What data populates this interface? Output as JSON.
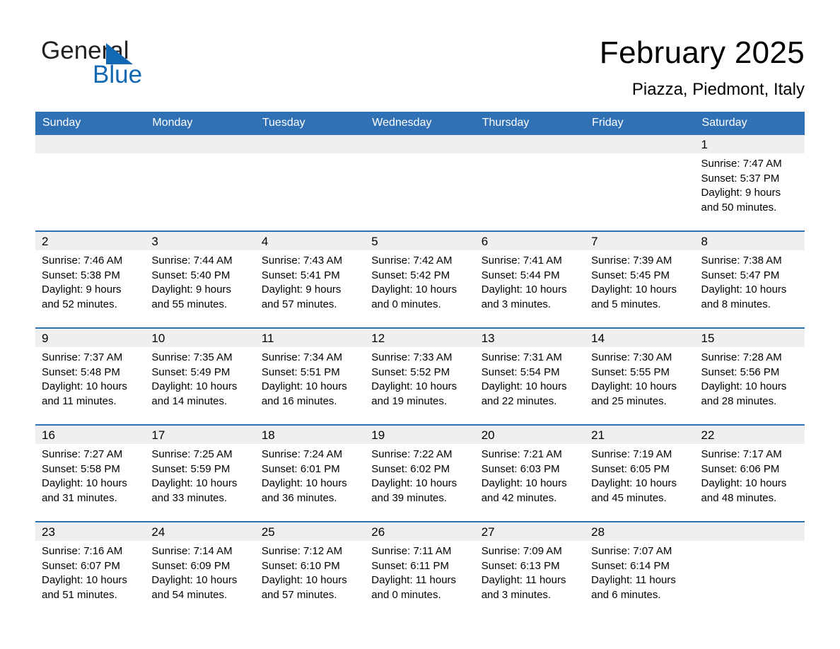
{
  "brand": {
    "name_part1": "General",
    "name_part2": "Blue",
    "triangle_color": "#1268b3"
  },
  "header": {
    "title": "February 2025",
    "subtitle": "Piazza, Piedmont, Italy",
    "accent_color": "#3071b5",
    "band_color": "#efefef"
  },
  "weekdays": [
    "Sunday",
    "Monday",
    "Tuesday",
    "Wednesday",
    "Thursday",
    "Friday",
    "Saturday"
  ],
  "weeks": [
    [
      {
        "day": "",
        "empty": true
      },
      {
        "day": "",
        "empty": true
      },
      {
        "day": "",
        "empty": true
      },
      {
        "day": "",
        "empty": true
      },
      {
        "day": "",
        "empty": true
      },
      {
        "day": "",
        "empty": true
      },
      {
        "day": "1",
        "sunrise": "Sunrise: 7:47 AM",
        "sunset": "Sunset: 5:37 PM",
        "daylight_line1": "Daylight: 9 hours",
        "daylight_line2": "and 50 minutes."
      }
    ],
    [
      {
        "day": "2",
        "sunrise": "Sunrise: 7:46 AM",
        "sunset": "Sunset: 5:38 PM",
        "daylight_line1": "Daylight: 9 hours",
        "daylight_line2": "and 52 minutes."
      },
      {
        "day": "3",
        "sunrise": "Sunrise: 7:44 AM",
        "sunset": "Sunset: 5:40 PM",
        "daylight_line1": "Daylight: 9 hours",
        "daylight_line2": "and 55 minutes."
      },
      {
        "day": "4",
        "sunrise": "Sunrise: 7:43 AM",
        "sunset": "Sunset: 5:41 PM",
        "daylight_line1": "Daylight: 9 hours",
        "daylight_line2": "and 57 minutes."
      },
      {
        "day": "5",
        "sunrise": "Sunrise: 7:42 AM",
        "sunset": "Sunset: 5:42 PM",
        "daylight_line1": "Daylight: 10 hours",
        "daylight_line2": "and 0 minutes."
      },
      {
        "day": "6",
        "sunrise": "Sunrise: 7:41 AM",
        "sunset": "Sunset: 5:44 PM",
        "daylight_line1": "Daylight: 10 hours",
        "daylight_line2": "and 3 minutes."
      },
      {
        "day": "7",
        "sunrise": "Sunrise: 7:39 AM",
        "sunset": "Sunset: 5:45 PM",
        "daylight_line1": "Daylight: 10 hours",
        "daylight_line2": "and 5 minutes."
      },
      {
        "day": "8",
        "sunrise": "Sunrise: 7:38 AM",
        "sunset": "Sunset: 5:47 PM",
        "daylight_line1": "Daylight: 10 hours",
        "daylight_line2": "and 8 minutes."
      }
    ],
    [
      {
        "day": "9",
        "sunrise": "Sunrise: 7:37 AM",
        "sunset": "Sunset: 5:48 PM",
        "daylight_line1": "Daylight: 10 hours",
        "daylight_line2": "and 11 minutes."
      },
      {
        "day": "10",
        "sunrise": "Sunrise: 7:35 AM",
        "sunset": "Sunset: 5:49 PM",
        "daylight_line1": "Daylight: 10 hours",
        "daylight_line2": "and 14 minutes."
      },
      {
        "day": "11",
        "sunrise": "Sunrise: 7:34 AM",
        "sunset": "Sunset: 5:51 PM",
        "daylight_line1": "Daylight: 10 hours",
        "daylight_line2": "and 16 minutes."
      },
      {
        "day": "12",
        "sunrise": "Sunrise: 7:33 AM",
        "sunset": "Sunset: 5:52 PM",
        "daylight_line1": "Daylight: 10 hours",
        "daylight_line2": "and 19 minutes."
      },
      {
        "day": "13",
        "sunrise": "Sunrise: 7:31 AM",
        "sunset": "Sunset: 5:54 PM",
        "daylight_line1": "Daylight: 10 hours",
        "daylight_line2": "and 22 minutes."
      },
      {
        "day": "14",
        "sunrise": "Sunrise: 7:30 AM",
        "sunset": "Sunset: 5:55 PM",
        "daylight_line1": "Daylight: 10 hours",
        "daylight_line2": "and 25 minutes."
      },
      {
        "day": "15",
        "sunrise": "Sunrise: 7:28 AM",
        "sunset": "Sunset: 5:56 PM",
        "daylight_line1": "Daylight: 10 hours",
        "daylight_line2": "and 28 minutes."
      }
    ],
    [
      {
        "day": "16",
        "sunrise": "Sunrise: 7:27 AM",
        "sunset": "Sunset: 5:58 PM",
        "daylight_line1": "Daylight: 10 hours",
        "daylight_line2": "and 31 minutes."
      },
      {
        "day": "17",
        "sunrise": "Sunrise: 7:25 AM",
        "sunset": "Sunset: 5:59 PM",
        "daylight_line1": "Daylight: 10 hours",
        "daylight_line2": "and 33 minutes."
      },
      {
        "day": "18",
        "sunrise": "Sunrise: 7:24 AM",
        "sunset": "Sunset: 6:01 PM",
        "daylight_line1": "Daylight: 10 hours",
        "daylight_line2": "and 36 minutes."
      },
      {
        "day": "19",
        "sunrise": "Sunrise: 7:22 AM",
        "sunset": "Sunset: 6:02 PM",
        "daylight_line1": "Daylight: 10 hours",
        "daylight_line2": "and 39 minutes."
      },
      {
        "day": "20",
        "sunrise": "Sunrise: 7:21 AM",
        "sunset": "Sunset: 6:03 PM",
        "daylight_line1": "Daylight: 10 hours",
        "daylight_line2": "and 42 minutes."
      },
      {
        "day": "21",
        "sunrise": "Sunrise: 7:19 AM",
        "sunset": "Sunset: 6:05 PM",
        "daylight_line1": "Daylight: 10 hours",
        "daylight_line2": "and 45 minutes."
      },
      {
        "day": "22",
        "sunrise": "Sunrise: 7:17 AM",
        "sunset": "Sunset: 6:06 PM",
        "daylight_line1": "Daylight: 10 hours",
        "daylight_line2": "and 48 minutes."
      }
    ],
    [
      {
        "day": "23",
        "sunrise": "Sunrise: 7:16 AM",
        "sunset": "Sunset: 6:07 PM",
        "daylight_line1": "Daylight: 10 hours",
        "daylight_line2": "and 51 minutes."
      },
      {
        "day": "24",
        "sunrise": "Sunrise: 7:14 AM",
        "sunset": "Sunset: 6:09 PM",
        "daylight_line1": "Daylight: 10 hours",
        "daylight_line2": "and 54 minutes."
      },
      {
        "day": "25",
        "sunrise": "Sunrise: 7:12 AM",
        "sunset": "Sunset: 6:10 PM",
        "daylight_line1": "Daylight: 10 hours",
        "daylight_line2": "and 57 minutes."
      },
      {
        "day": "26",
        "sunrise": "Sunrise: 7:11 AM",
        "sunset": "Sunset: 6:11 PM",
        "daylight_line1": "Daylight: 11 hours",
        "daylight_line2": "and 0 minutes."
      },
      {
        "day": "27",
        "sunrise": "Sunrise: 7:09 AM",
        "sunset": "Sunset: 6:13 PM",
        "daylight_line1": "Daylight: 11 hours",
        "daylight_line2": "and 3 minutes."
      },
      {
        "day": "28",
        "sunrise": "Sunrise: 7:07 AM",
        "sunset": "Sunset: 6:14 PM",
        "daylight_line1": "Daylight: 11 hours",
        "daylight_line2": "and 6 minutes."
      },
      {
        "day": "",
        "empty": true,
        "blank_cell": true
      }
    ]
  ]
}
